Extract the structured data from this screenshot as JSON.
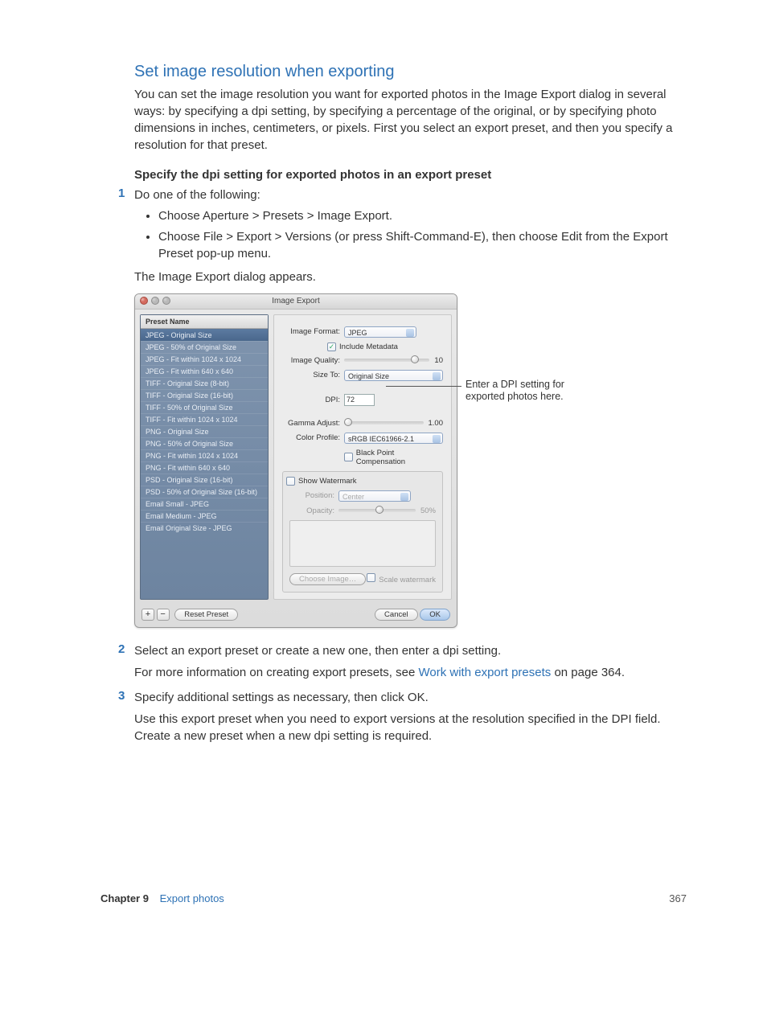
{
  "heading": "Set image resolution when exporting",
  "intro": "You can set the image resolution you want for exported photos in the Image Export dialog in several ways: by specifying a dpi setting, by specifying a percentage of the original, or by specifying photo dimensions in inches, centimeters, or pixels. First you select an export preset, and then you specify a resolution for that preset.",
  "sub_heading": "Specify the dpi setting for exported photos in an export preset",
  "steps": {
    "s1": {
      "num": "1",
      "text": "Do one of the following:"
    },
    "s2": {
      "num": "2",
      "text": "Select an export preset or create a new one, then enter a dpi setting."
    },
    "s3": {
      "num": "3",
      "text": "Specify additional settings as necessary, then click OK."
    }
  },
  "bullets": {
    "b1": "Choose Aperture > Presets > Image Export.",
    "b2": "Choose File > Export > Versions (or press Shift-Command-E), then choose Edit from the Export Preset pop-up menu."
  },
  "after_bullets": "The Image Export dialog appears.",
  "after_s2_a": "For more information on creating export presets, see ",
  "after_s2_link": "Work with export presets",
  "after_s2_b": " on page 364.",
  "after_s3": "Use this export preset when you need to export versions at the resolution specified in the DPI field. Create a new preset when a new dpi setting is required.",
  "dialog": {
    "title": "Image Export",
    "sidebar_header": "Preset Name",
    "presets": [
      "JPEG - Original Size",
      "JPEG - 50% of Original Size",
      "JPEG - Fit within 1024 x 1024",
      "JPEG - Fit within 640 x 640",
      "TIFF - Original Size (8-bit)",
      "TIFF - Original Size (16-bit)",
      "TIFF - 50% of Original Size",
      "TIFF - Fit within 1024 x 1024",
      "PNG - Original Size",
      "PNG - 50% of Original Size",
      "PNG - Fit within 1024 x 1024",
      "PNG - Fit within 640 x 640",
      "PSD - Original Size (16-bit)",
      "PSD - 50% of Original Size (16-bit)",
      "Email Small - JPEG",
      "Email Medium - JPEG",
      "Email Original Size - JPEG"
    ],
    "labels": {
      "image_format": "Image Format:",
      "include_metadata": "Include Metadata",
      "image_quality": "Image Quality:",
      "size_to": "Size To:",
      "dpi": "DPI:",
      "gamma": "Gamma Adjust:",
      "color_profile": "Color Profile:",
      "black_point": "Black Point Compensation",
      "show_watermark": "Show Watermark",
      "position": "Position:",
      "opacity": "Opacity:",
      "choose_image": "Choose Image…",
      "scale_watermark": "Scale watermark"
    },
    "values": {
      "image_format": "JPEG",
      "image_quality": "10",
      "size_to": "Original Size",
      "dpi": "72",
      "gamma": "1.00",
      "color_profile": "sRGB IEC61966-2.1",
      "position": "Center",
      "opacity": "50%"
    },
    "footer": {
      "add": "+",
      "remove": "−",
      "reset": "Reset Preset",
      "cancel": "Cancel",
      "ok": "OK"
    }
  },
  "callout": "Enter a DPI setting for exported photos here.",
  "footer": {
    "chapter": "Chapter 9",
    "title": "Export photos",
    "page": "367"
  }
}
